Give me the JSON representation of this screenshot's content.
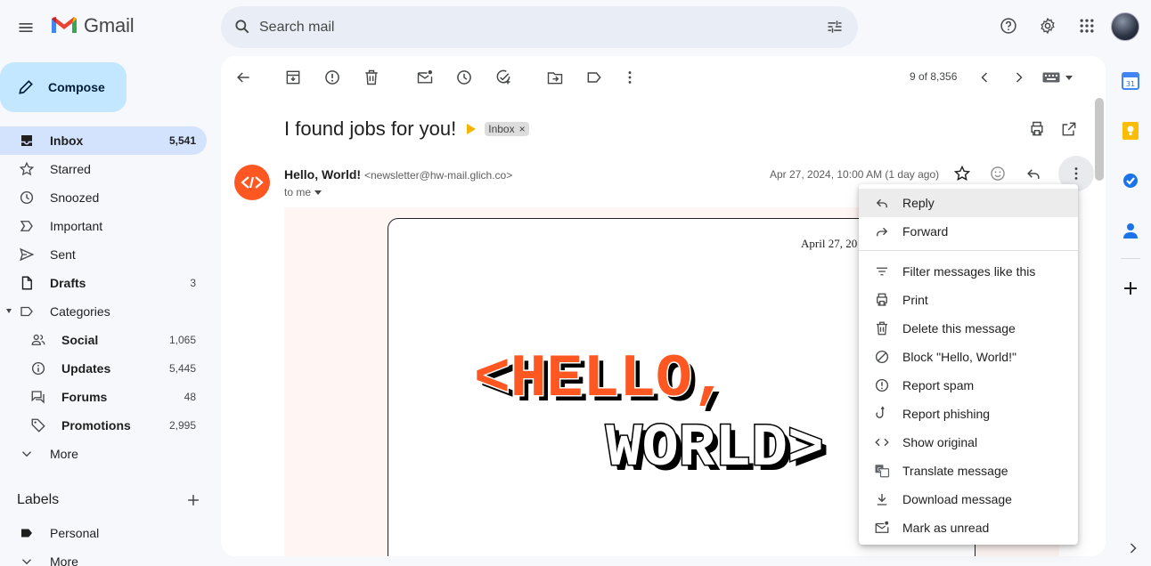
{
  "app": {
    "name": "Gmail",
    "search_placeholder": "Search mail"
  },
  "sidebar": {
    "compose_label": "Compose",
    "items": [
      {
        "label": "Inbox",
        "count": "5,541",
        "icon": "inbox-icon"
      },
      {
        "label": "Starred",
        "count": "",
        "icon": "star-icon"
      },
      {
        "label": "Snoozed",
        "count": "",
        "icon": "clock-icon"
      },
      {
        "label": "Important",
        "count": "",
        "icon": "label-important-icon"
      },
      {
        "label": "Sent",
        "count": "",
        "icon": "send-icon"
      },
      {
        "label": "Drafts",
        "count": "3",
        "icon": "draft-icon"
      },
      {
        "label": "Categories",
        "count": "",
        "icon": "label-icon"
      },
      {
        "label": "Social",
        "count": "1,065",
        "icon": "people-icon"
      },
      {
        "label": "Updates",
        "count": "5,445",
        "icon": "info-icon"
      },
      {
        "label": "Forums",
        "count": "48",
        "icon": "forum-icon"
      },
      {
        "label": "Promotions",
        "count": "2,995",
        "icon": "tag-icon"
      },
      {
        "label": "More",
        "count": "",
        "icon": "chevron-down-icon"
      }
    ],
    "labels_heading": "Labels",
    "label_items": [
      {
        "label": "Personal"
      },
      {
        "label": "More"
      }
    ]
  },
  "toolbar": {
    "pager": "9 of 8,356"
  },
  "email": {
    "subject": "I found jobs for you!",
    "chip_label": "Inbox",
    "chip_close": "×",
    "sender_name": "Hello, World!",
    "sender_email": "<newsletter@hw-mail.glich.co>",
    "recipient": "to me",
    "date": "Apr 27, 2024, 10:00 AM (1 day ago)",
    "card_date": "April 27, 20",
    "hero_line1": "<HELLO,",
    "hero_line2": "WORLD>"
  },
  "context_menu": {
    "items_top": [
      {
        "label": "Reply",
        "icon": "reply-icon"
      },
      {
        "label": "Forward",
        "icon": "forward-icon"
      }
    ],
    "items": [
      {
        "label": "Filter messages like this",
        "icon": "filter-icon"
      },
      {
        "label": "Print",
        "icon": "print-icon"
      },
      {
        "label": "Delete this message",
        "icon": "trash-icon"
      },
      {
        "label": "Block \"Hello, World!\"",
        "icon": "block-icon"
      },
      {
        "label": "Report spam",
        "icon": "report-icon"
      },
      {
        "label": "Report phishing",
        "icon": "phishing-icon"
      },
      {
        "label": "Show original",
        "icon": "code-icon"
      },
      {
        "label": "Translate message",
        "icon": "translate-icon"
      },
      {
        "label": "Download message",
        "icon": "download-icon"
      },
      {
        "label": "Mark as unread",
        "icon": "mark-unread-icon"
      }
    ]
  },
  "colors": {
    "compose_bg": "#c2e7ff",
    "inbox_active_bg": "#d3e3fd",
    "brand_orange": "#ff5722"
  }
}
